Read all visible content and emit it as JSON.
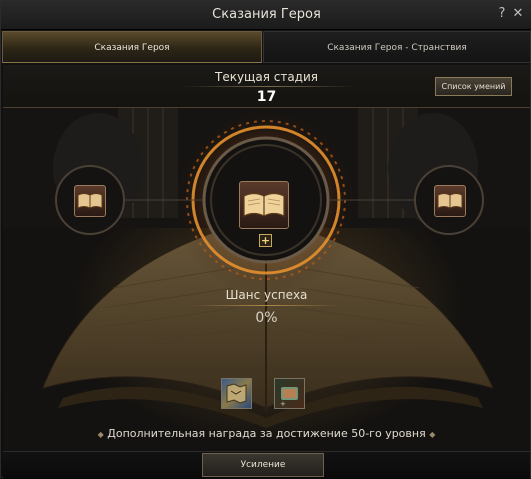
{
  "window": {
    "title": "Сказания Героя",
    "help_icon": "?",
    "close_icon": "✕"
  },
  "tabs": [
    {
      "label": "Сказания Героя",
      "active": true
    },
    {
      "label": "Сказания Героя - Странствия",
      "active": false
    }
  ],
  "stage": {
    "label": "Текущая стадия",
    "value": "17"
  },
  "skills_button": "Список умений",
  "success": {
    "label": "Шанс успеха",
    "value": "0%"
  },
  "reward": {
    "items": [
      "map-item-icon",
      "scroll-item-icon"
    ],
    "text": "Дополнительная награда за достижение 50-го уровня"
  },
  "enhance_button": "Усиление",
  "colors": {
    "accent_glow": "#e08a2a",
    "frame_gold": "#c9a85a",
    "book_red": "#6a3a2a"
  }
}
